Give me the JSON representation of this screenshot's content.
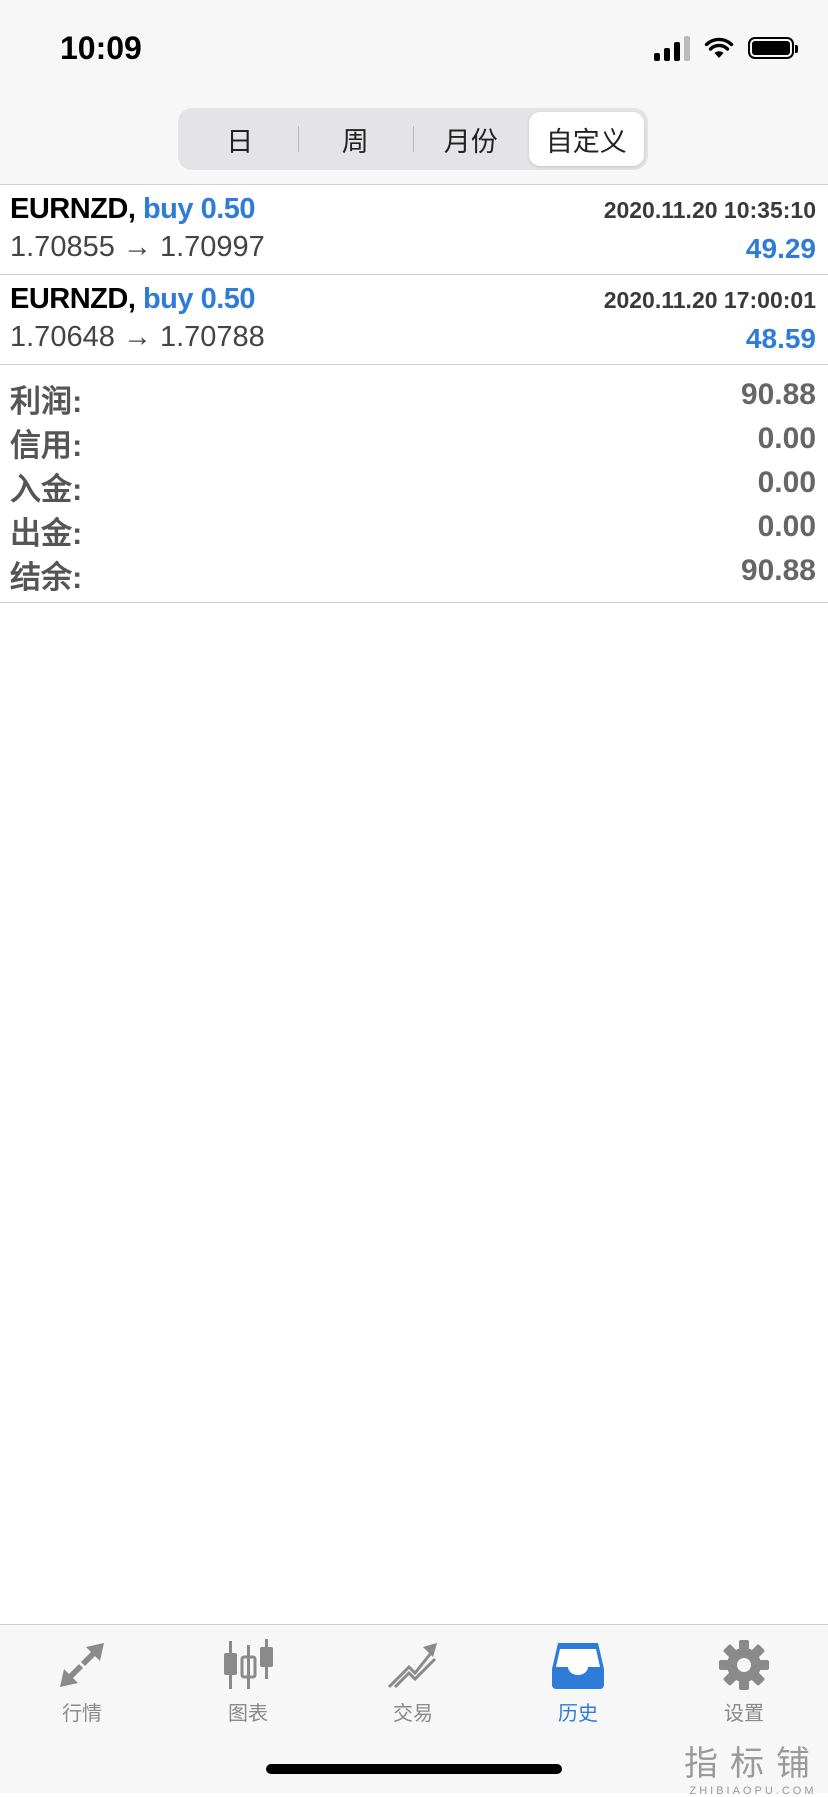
{
  "status_bar": {
    "time": "10:09"
  },
  "period_tabs": [
    {
      "label": "日",
      "active": false
    },
    {
      "label": "周",
      "active": false
    },
    {
      "label": "月份",
      "active": false
    },
    {
      "label": "自定义",
      "active": true
    }
  ],
  "trades": [
    {
      "symbol": "EURNZD,",
      "side": "buy 0.50",
      "time": "2020.11.20 10:35:10",
      "prices": "1.70855 → 1.70997",
      "profit": "49.29"
    },
    {
      "symbol": "EURNZD,",
      "side": "buy 0.50",
      "time": "2020.11.20 17:00:01",
      "prices": "1.70648 → 1.70788",
      "profit": "48.59"
    }
  ],
  "summary": [
    {
      "label": "利润:",
      "value": "90.88"
    },
    {
      "label": "信用:",
      "value": "0.00"
    },
    {
      "label": "入金:",
      "value": "0.00"
    },
    {
      "label": "出金:",
      "value": "0.00"
    },
    {
      "label": "结余:",
      "value": "90.88"
    }
  ],
  "tabbar": [
    {
      "label": "行情",
      "icon": "quotes-arrows-icon",
      "active": false
    },
    {
      "label": "图表",
      "icon": "candlestick-chart-icon",
      "active": false
    },
    {
      "label": "交易",
      "icon": "trade-trend-icon",
      "active": false
    },
    {
      "label": "历史",
      "icon": "history-inbox-icon",
      "active": true
    },
    {
      "label": "设置",
      "icon": "gear-icon",
      "active": false
    }
  ],
  "watermark": {
    "cn": "指标铺",
    "en": "ZHIBIAOPU.COM"
  },
  "colors": {
    "accent": "#2f7bd8",
    "inactive": "#8a8a8a",
    "separator": "#cfcfcf"
  }
}
